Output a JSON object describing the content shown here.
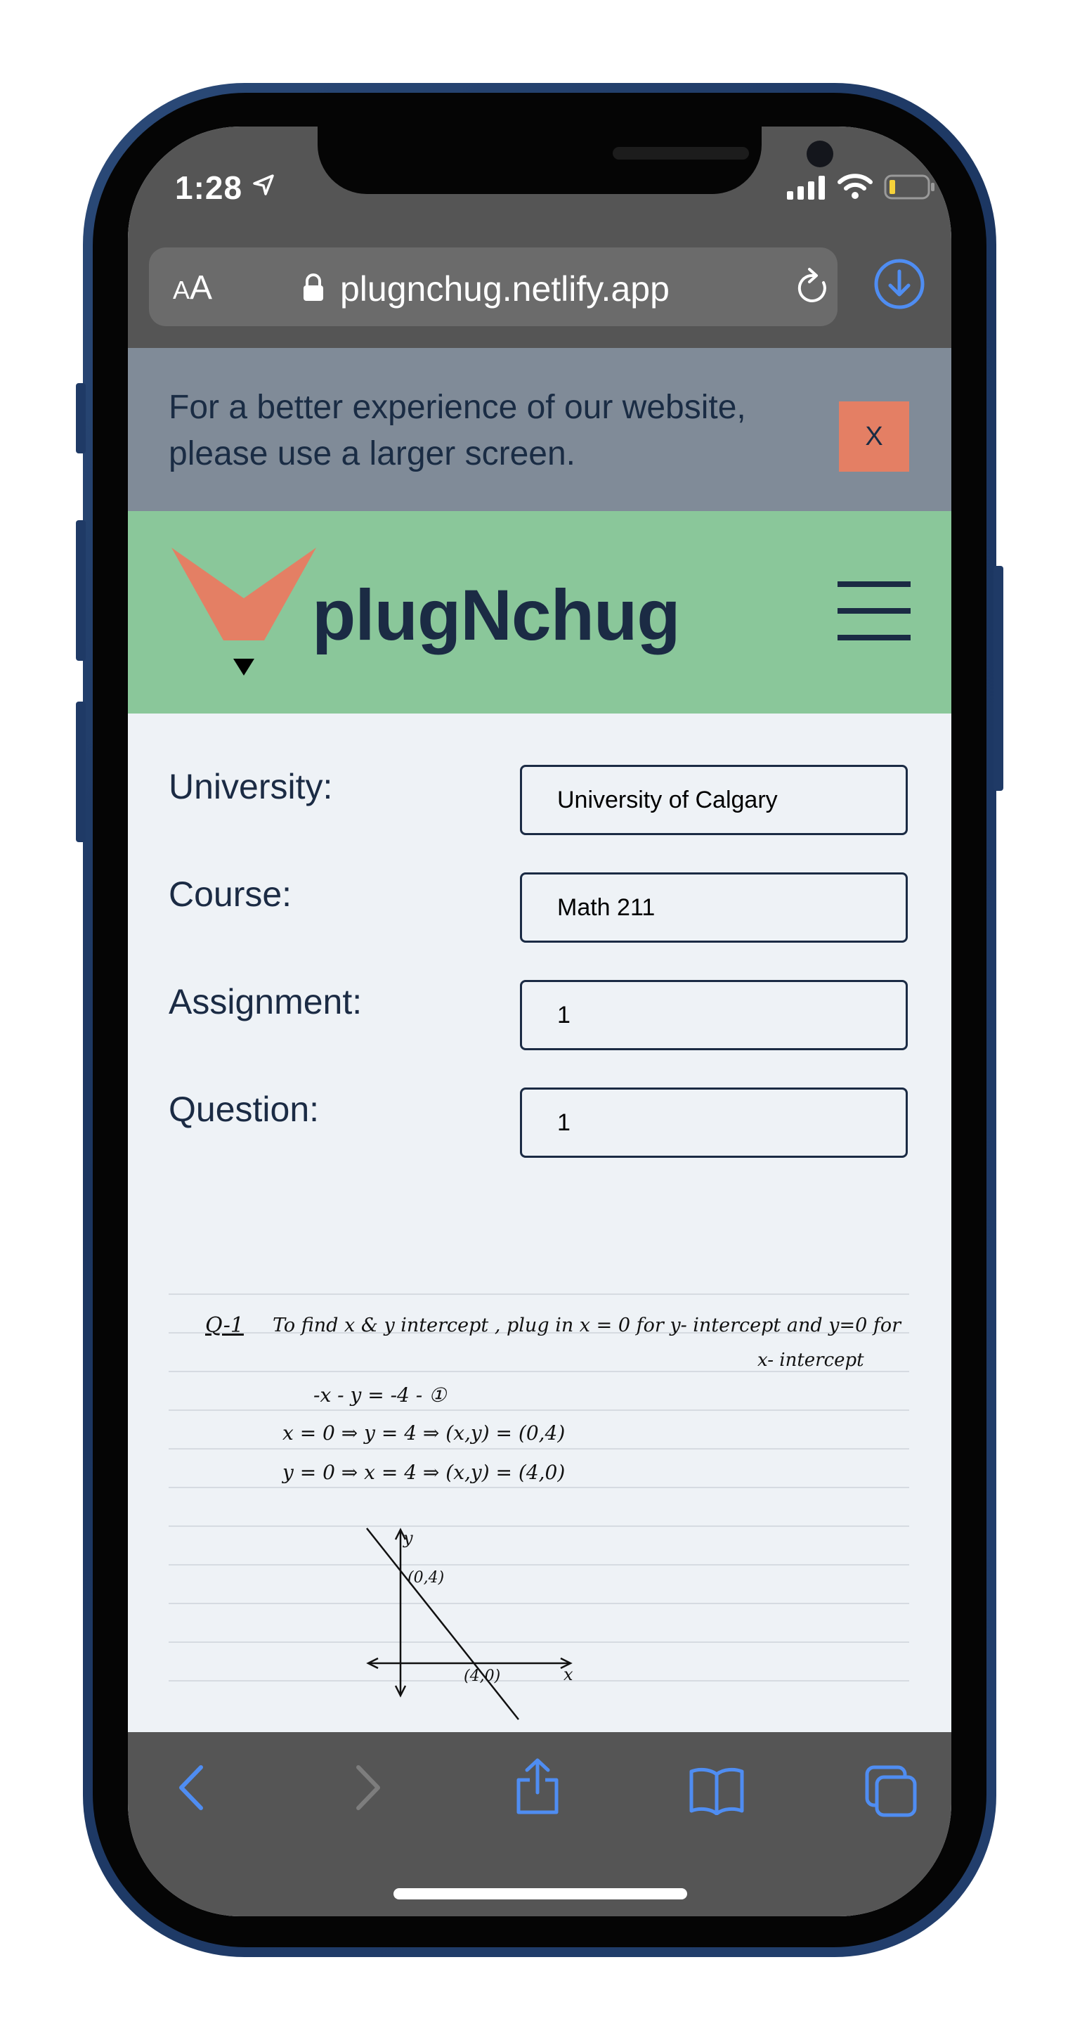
{
  "status_bar": {
    "time": "1:28"
  },
  "browser": {
    "text_size_small": "A",
    "text_size_large": "A",
    "url": "plugnchug.netlify.app"
  },
  "banner": {
    "message": "For a better experience of our website, please use a larger screen.",
    "close_label": "X"
  },
  "header": {
    "brand": "plugNchug"
  },
  "form": {
    "university_label": "University:",
    "university_value": "University of Calgary",
    "course_label": "Course:",
    "course_value": "Math 211",
    "assignment_label": "Assignment:",
    "assignment_value": "1",
    "question_label": "Question:",
    "question_value": "1"
  },
  "solution_note": {
    "heading": "Q-1",
    "intro_line1": "To find x & y intercept , plug in x = 0 for y- intercept and y=0 for",
    "intro_line2": "x- intercept",
    "eq1": "-x - y = -4   -  ①",
    "eq2": "x = 0 ⇒ y = 4 ⇒ (x,y) = (0,4)",
    "eq3": "y = 0 ⇒ x = 4 ⇒ (x,y) = (4,0)",
    "graph_y_label": "y",
    "graph_x_label": "x",
    "point_a": "(0,4)",
    "point_b": "(4,0)"
  },
  "colors": {
    "banner_bg": "#808b98",
    "close_button": "#e47f64",
    "header_bg": "#8ac79a",
    "brand_text": "#1b2b44",
    "logo": "#e47f64",
    "toolbar_icon": "#4f8df2"
  }
}
